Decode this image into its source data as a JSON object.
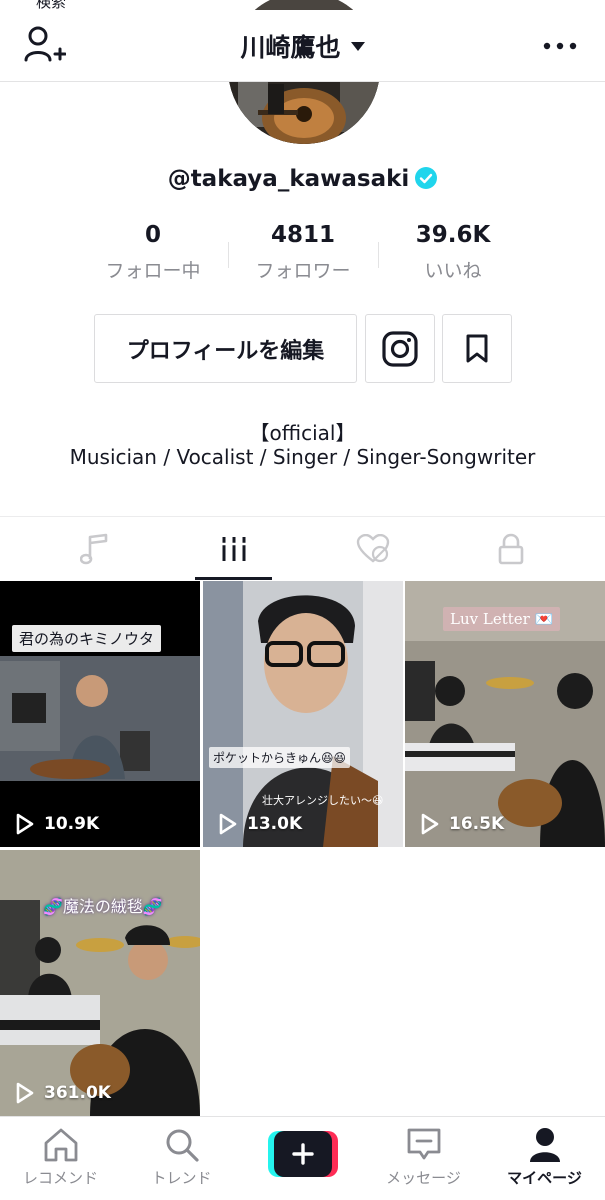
{
  "status_bar": {
    "text": "検索"
  },
  "header": {
    "title": "川崎鷹也"
  },
  "profile": {
    "username": "@takaya_kawasaki",
    "stats": [
      {
        "value": "0",
        "label": "フォロー中"
      },
      {
        "value": "4811",
        "label": "フォロワー"
      },
      {
        "value": "39.6K",
        "label": "いいね"
      }
    ],
    "edit_label": "プロフィールを編集",
    "bio_line1": "【official】",
    "bio_line2": "Musician / Vocalist / Singer / Singer-Songwriter"
  },
  "tabs": [
    {
      "icon": "music-note-icon",
      "active": false
    },
    {
      "icon": "grid-icon",
      "active": true
    },
    {
      "icon": "liked-hidden-icon",
      "active": false
    },
    {
      "icon": "lock-icon",
      "active": false
    }
  ],
  "videos": [
    {
      "caption": "君の為のキミノウタ",
      "views": "10.9K"
    },
    {
      "caption": "ポケットからきゅん😆😆",
      "caption2": "壮大アレンジしたい〜😆",
      "views": "13.0K"
    },
    {
      "caption": "Luv Letter 💌",
      "views": "16.5K"
    },
    {
      "caption": "🧬魔法の絨毯🧬",
      "views": "361.0K"
    }
  ],
  "bottom_nav": [
    {
      "label": "レコメンド",
      "icon": "home-icon"
    },
    {
      "label": "トレンド",
      "icon": "search-icon"
    },
    {
      "label": "",
      "icon": "plus-icon"
    },
    {
      "label": "メッセージ",
      "icon": "inbox-icon"
    },
    {
      "label": "マイページ",
      "icon": "profile-icon",
      "active": true
    }
  ],
  "colors": {
    "accent_cyan": "#25f4ee",
    "accent_red": "#fe2c55",
    "verified": "#20d5ec",
    "text": "#161823",
    "muted": "#8a8b91"
  }
}
